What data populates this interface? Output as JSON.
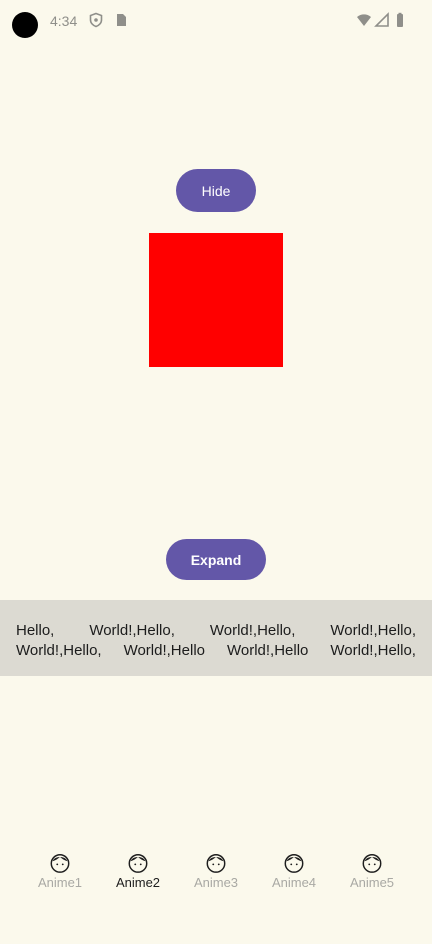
{
  "status_bar": {
    "time": "4:34",
    "icons": [
      "shield-icon",
      "sim-card-icon",
      "wifi-icon",
      "signal-icon",
      "battery-icon"
    ]
  },
  "buttons": {
    "hide_label": "Hide",
    "expand_label": "Expand"
  },
  "marquee": {
    "line1": [
      "Hello,",
      "World!,Hello,",
      "World!,Hello,",
      "World!,Hello,"
    ],
    "line2": [
      "World!,Hello,",
      "World!,Hello",
      "World!,Hello",
      "World!,Hello,"
    ]
  },
  "bottom_nav": {
    "items": [
      {
        "label": "Anime1",
        "icon": "face-icon",
        "active": false
      },
      {
        "label": "Anime2",
        "icon": "face-icon",
        "active": true
      },
      {
        "label": "Anime3",
        "icon": "face-icon",
        "active": false
      },
      {
        "label": "Anime4",
        "icon": "face-icon",
        "active": false
      },
      {
        "label": "Anime5",
        "icon": "face-icon",
        "active": false
      }
    ]
  },
  "colors": {
    "background": "#fbf9ec",
    "button": "#6357a8",
    "box": "#ff0000",
    "marquee_band": "#dcdad2"
  }
}
